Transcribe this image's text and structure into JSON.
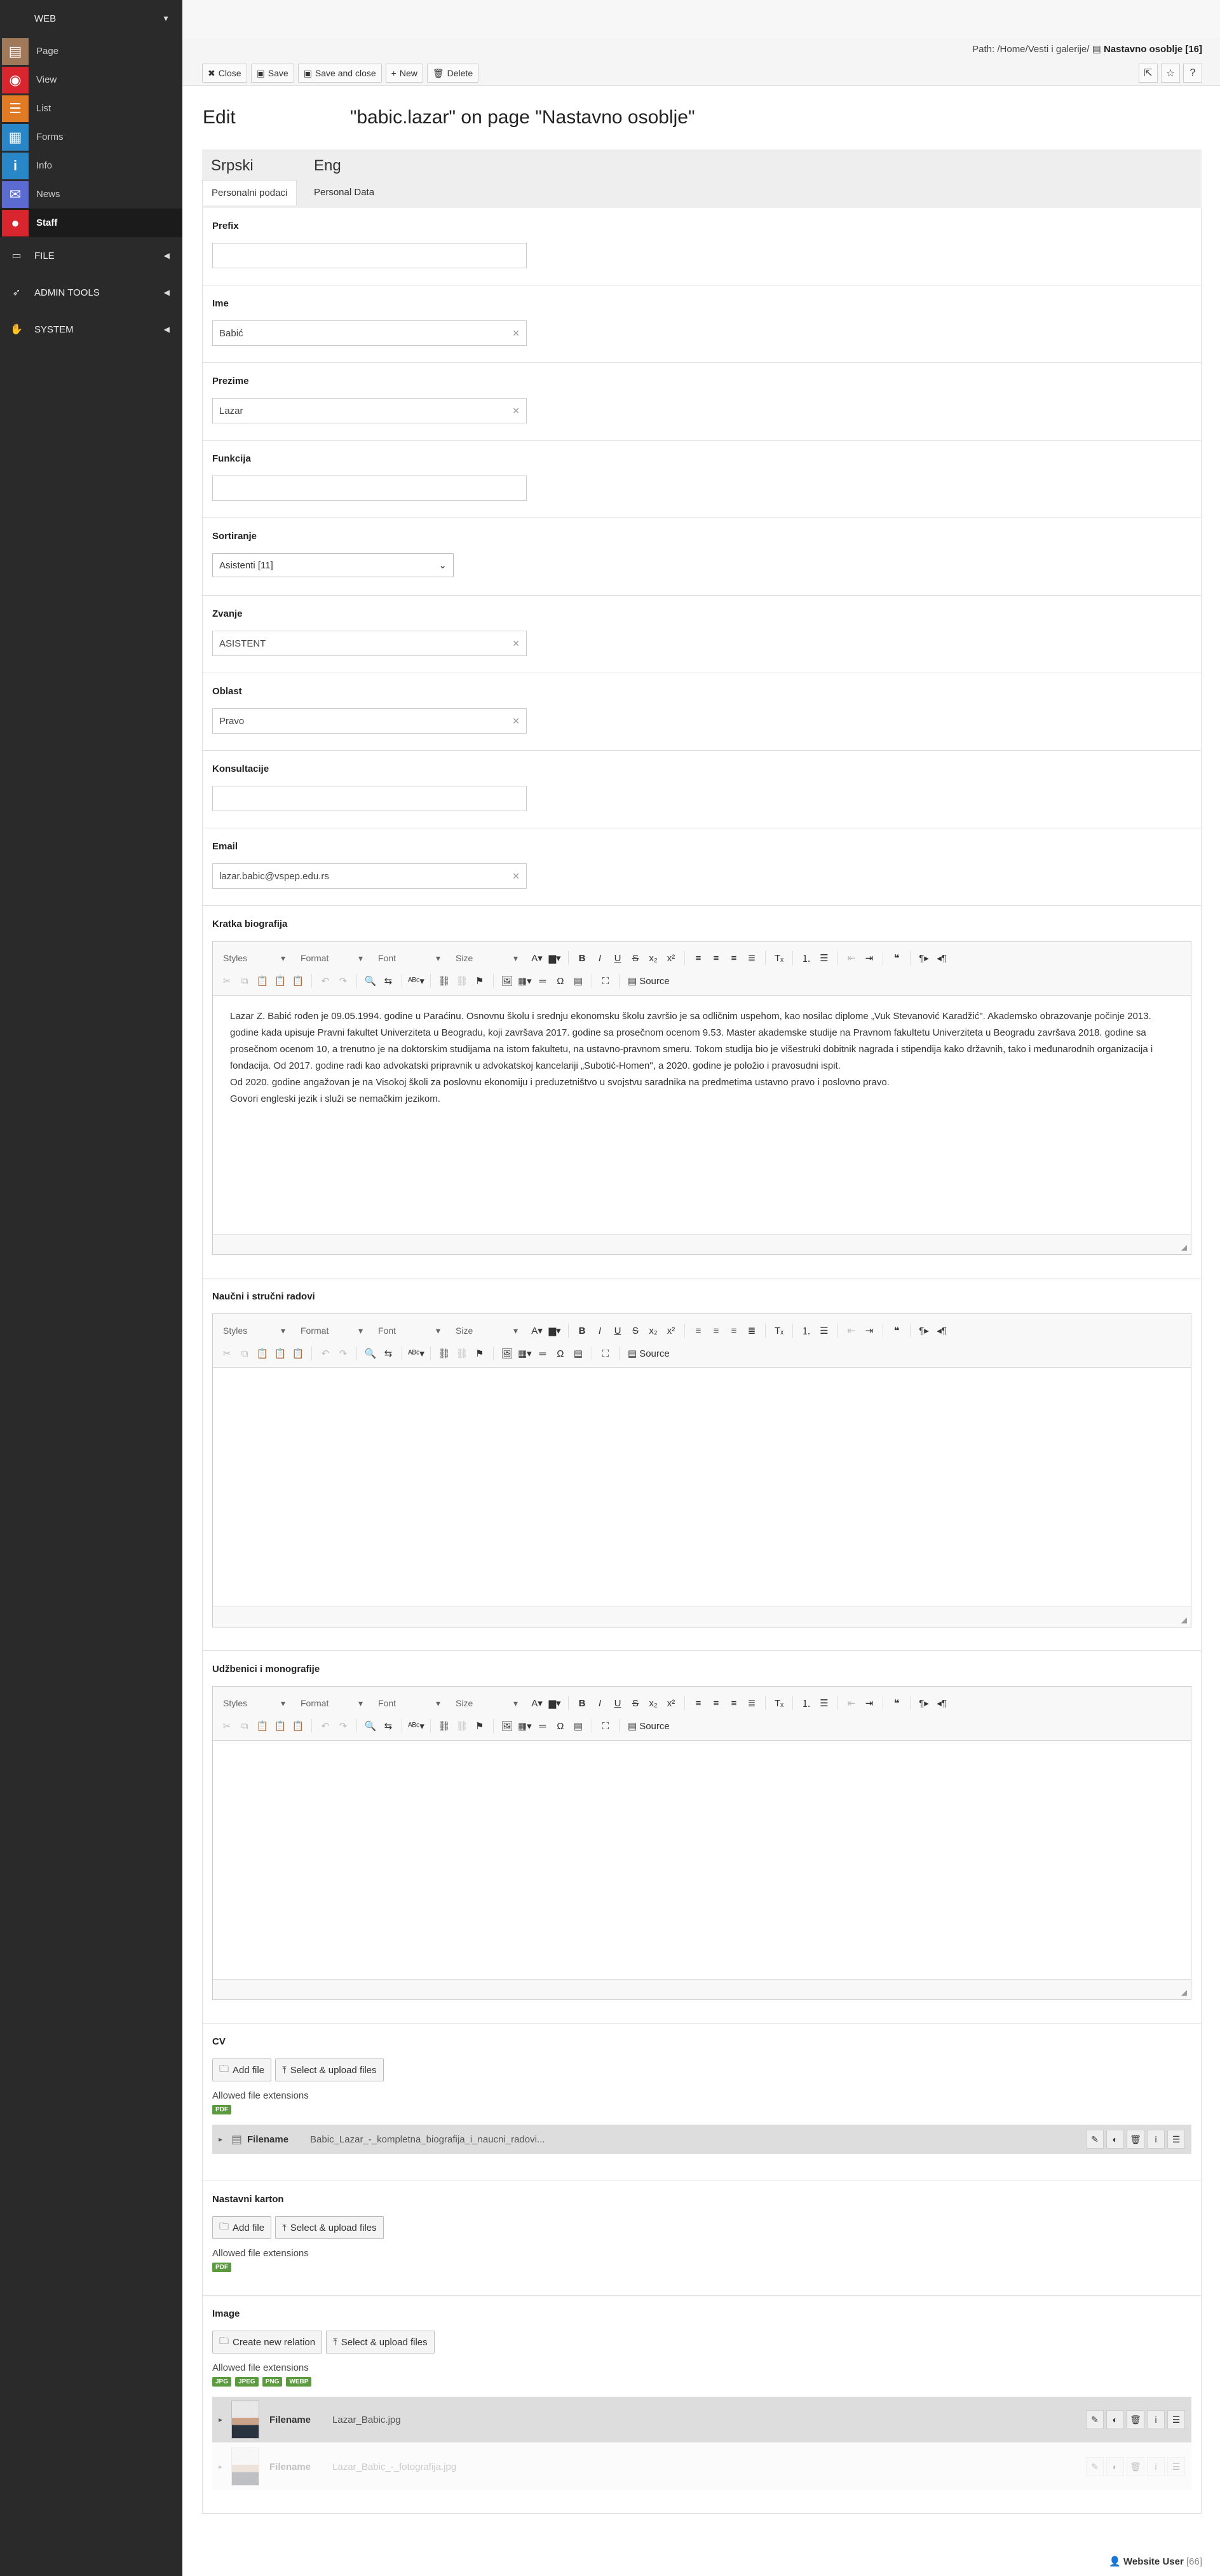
{
  "sidebar": {
    "groups": {
      "web": "WEB",
      "file": "FILE",
      "admin_tools": "ADMIN TOOLS",
      "system": "SYSTEM"
    },
    "items": [
      {
        "label": "Page",
        "color": "#a0785a"
      },
      {
        "label": "View",
        "color": "#d9262e"
      },
      {
        "label": "List",
        "color": "#e07b23"
      },
      {
        "label": "Forms",
        "color": "#2a87c7"
      },
      {
        "label": "Info",
        "color": "#2a87c7"
      },
      {
        "label": "News",
        "color": "#5b6bd1"
      },
      {
        "label": "Staff",
        "color": "#d9262e"
      }
    ]
  },
  "path": {
    "prefix": "Path: /Home/Vesti i galerije/",
    "current": "Nastavno osoblje [16]"
  },
  "toolbar": {
    "close": "Close",
    "save": "Save",
    "save_close": "Save and close",
    "new": "New",
    "delete": "Delete"
  },
  "title": {
    "mode": "Edit",
    "record": "\"babic.lazar\" on page \"Nastavno osoblje\""
  },
  "languages": [
    {
      "name": "Srpski",
      "tab": "Personalni podaci"
    },
    {
      "name": "Eng",
      "tab": "Personal Data"
    }
  ],
  "fields": {
    "prefix": {
      "label": "Prefix",
      "value": ""
    },
    "ime": {
      "label": "Ime",
      "value": "Babić"
    },
    "prezime": {
      "label": "Prezime",
      "value": "Lazar"
    },
    "funkcija": {
      "label": "Funkcija",
      "value": ""
    },
    "sortiranje": {
      "label": "Sortiranje",
      "value": "Asistenti [11]"
    },
    "zvanje": {
      "label": "Zvanje",
      "value": "ASISTENT"
    },
    "oblast": {
      "label": "Oblast",
      "value": "Pravo"
    },
    "konsultacije": {
      "label": "Konsultacije",
      "value": ""
    },
    "email": {
      "label": "Email",
      "value": "lazar.babic@vspep.edu.rs"
    }
  },
  "editor_toolbar": {
    "styles": "Styles",
    "format": "Format",
    "font": "Font",
    "size": "Size",
    "source": "Source"
  },
  "editors": {
    "kratka": {
      "label": "Kratka biografija",
      "paragraphs": [
        "Lazar Z. Babić rođen je 09.05.1994. godine u Paraćinu. Osnovnu školu i srednju ekonomsku školu završio je sa odličnim uspehom, kao nosilac diplome „Vuk Stevanović Karadžić\". Akademsko obrazovanje počinje 2013. godine kada upisuje Pravni fakultet Univerziteta u Beogradu, koji završava 2017. godine sa prosečnom ocenom 9.53. Master akademske studije na Pravnom fakultetu Univerziteta u Beogradu završava 2018. godine sa prosečnom ocenom 10, a trenutno je na doktorskim studijama na istom fakultetu, na ustavno-pravnom smeru. Tokom studija bio je višestruki dobitnik nagrada i stipendija kako državnih, tako i međunarodnih organizacija i fondacija. Od 2017. godine radi kao advokatski pripravnik u advokatskoj kancelariji „Subotić-Homen\", a 2020. godine je položio i pravosudni ispit.",
        "Od 2020. godine angažovan je na Visokoj školi za poslovnu ekonomiju i preduzetništvo u svojstvu saradnika na predmetima ustavno pravo i poslovno pravo.",
        "Govori engleski jezik i služi se nemačkim jezikom."
      ]
    },
    "naucni": {
      "label": "Naučni i stručni radovi"
    },
    "udzbenici": {
      "label": "Udžbenici i monografije"
    }
  },
  "uploads": {
    "cv": {
      "label": "CV",
      "add": "Add file",
      "upload": "Select & upload files",
      "allowed": "Allowed file extensions",
      "ext": [
        "PDF"
      ],
      "file_key": "Filename",
      "file_value": "Babic_Lazar_-_kompletna_biografija_i_naucni_radovi..."
    },
    "karton": {
      "label": "Nastavni karton",
      "add": "Add file",
      "upload": "Select & upload files",
      "allowed": "Allowed file extensions",
      "ext": [
        "PDF"
      ]
    },
    "image": {
      "label": "Image",
      "create": "Create new relation",
      "upload": "Select & upload files",
      "allowed": "Allowed file extensions",
      "ext": [
        "JPG",
        "JPEG",
        "PNG",
        "WEBP"
      ],
      "files": [
        {
          "key": "Filename",
          "value": "Lazar_Babic.jpg"
        },
        {
          "key": "Filename",
          "value": "Lazar_Babic_-_fotografija.jpg"
        }
      ]
    }
  },
  "footer": {
    "user": "Website User",
    "id": "[66]"
  },
  "colors": {
    "badge": "#5b9a3e",
    "sidebar": "#2a2a2a"
  }
}
